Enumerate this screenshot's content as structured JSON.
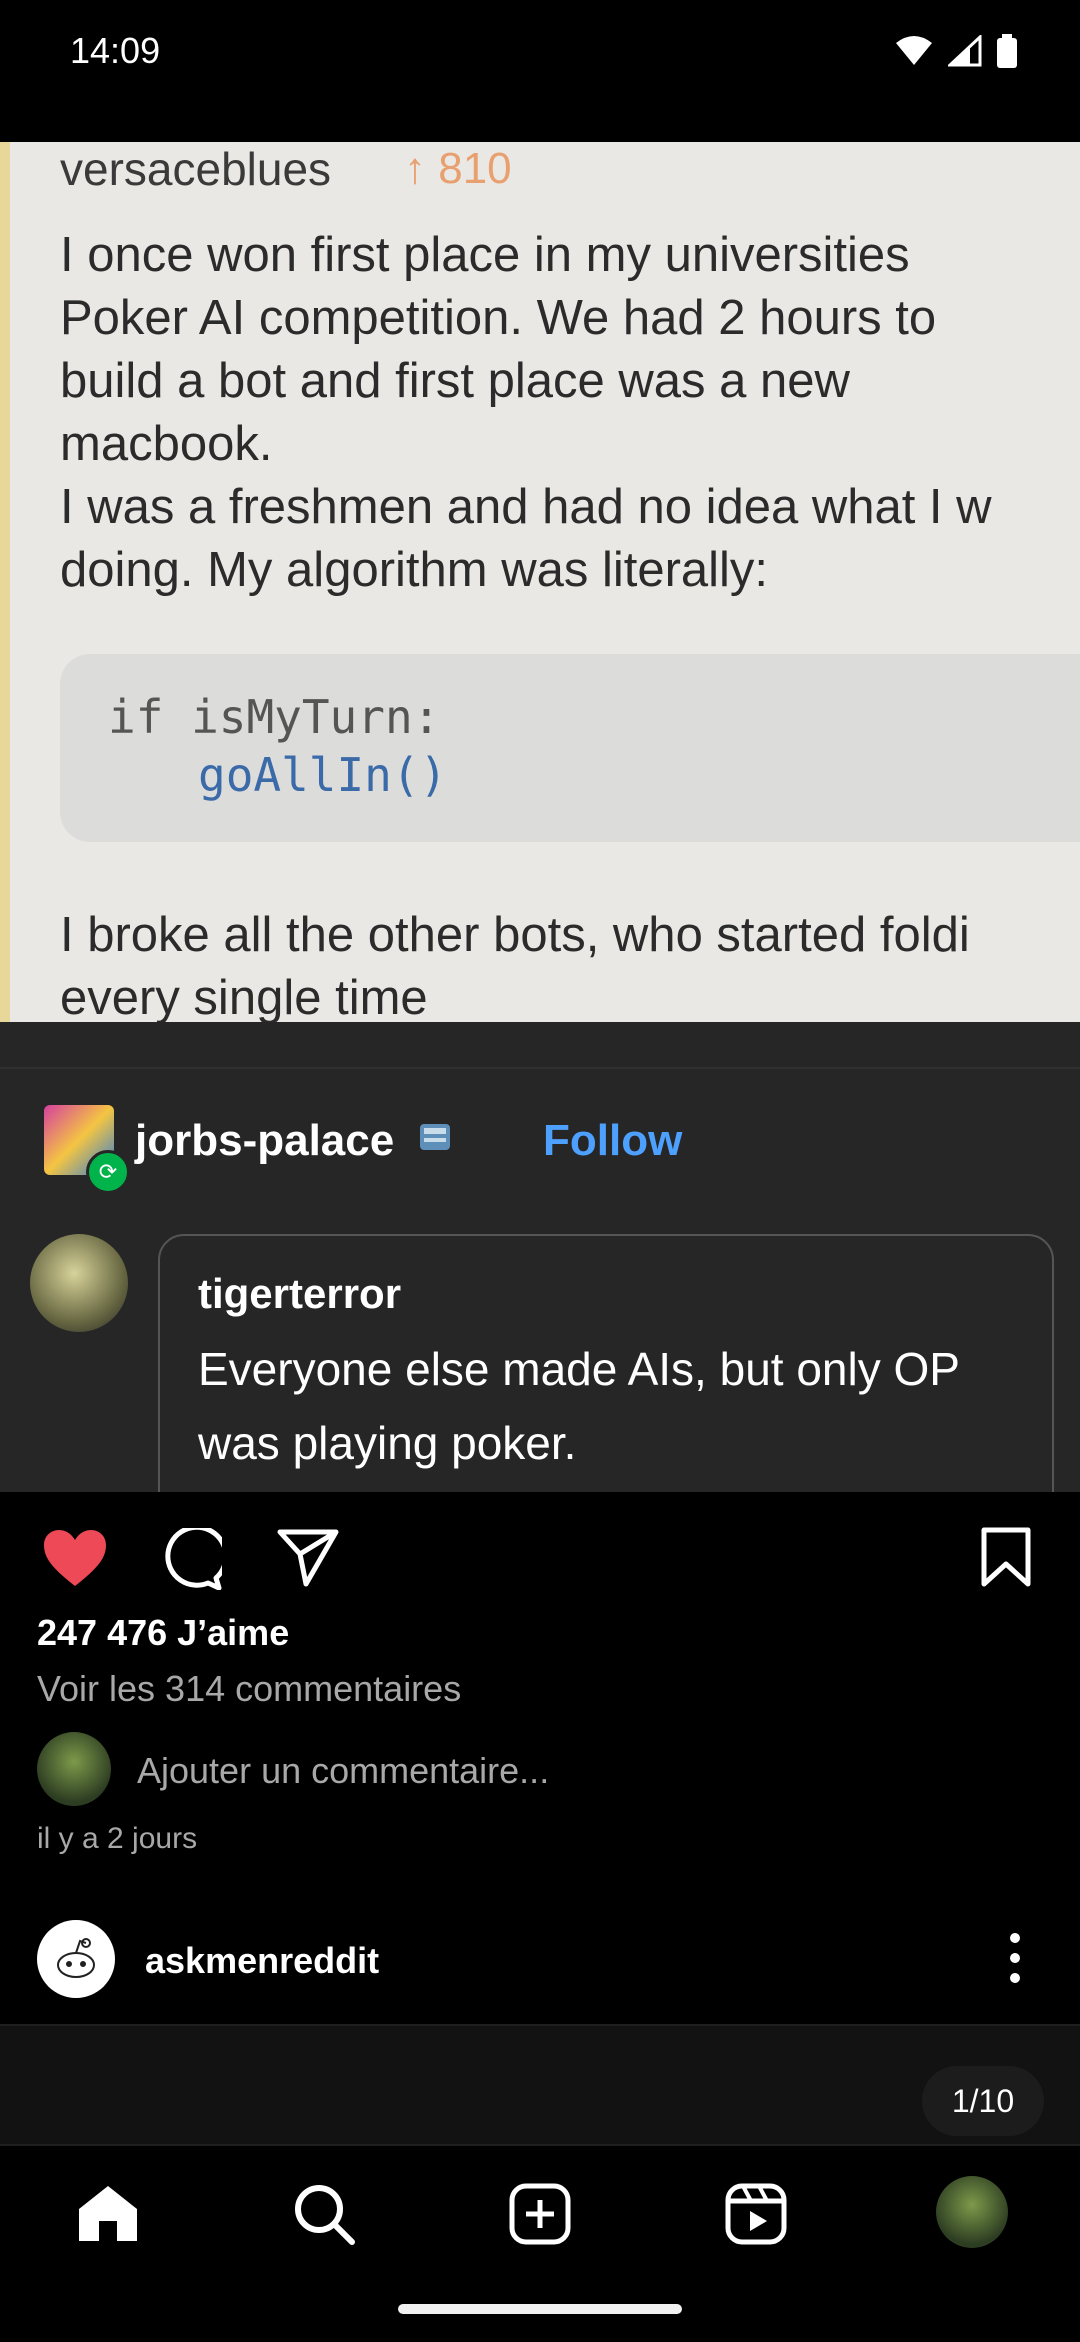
{
  "status_bar": {
    "time": "14:09",
    "icons": [
      "wifi-icon",
      "signal-icon",
      "battery-icon"
    ]
  },
  "screenshot_post": {
    "username": "versaceblues",
    "votes": "↑ 810",
    "paragraph": "I once won first place in my universities\nPoker AI competition. We had 2 hours to\nbuild a bot and first place was a new\nmacbook.\nI was a freshmen and had no idea what I w\ndoing. My algorithm was literally:",
    "code_line1": "if isMyTurn:",
    "code_line2": "goAllIn()",
    "paragraph2": "I broke all the other bots, who started foldi\nevery single time"
  },
  "reblog": {
    "blog_name": "jorbs-palace",
    "follow_label": "Follow",
    "comment_user": "tigerterror",
    "comment_text": "Everyone else made AIs, but only OP was playing poker."
  },
  "actions": {
    "icons": [
      "heart-icon",
      "comment-icon",
      "share-icon",
      "bookmark-icon"
    ],
    "liked_color": "#ed4956"
  },
  "post_meta": {
    "likes": "247 476 J’aime",
    "view_comments": "Voir les 314 commentaires",
    "add_comment_placeholder": "Ajouter un commentaire...",
    "time_ago": "il y a 2 jours"
  },
  "next_post": {
    "username": "askmenreddit",
    "pager": "1/10"
  },
  "bottom_nav": {
    "items": [
      "home-icon",
      "search-icon",
      "create-icon",
      "reels-icon",
      "profile-avatar"
    ]
  }
}
